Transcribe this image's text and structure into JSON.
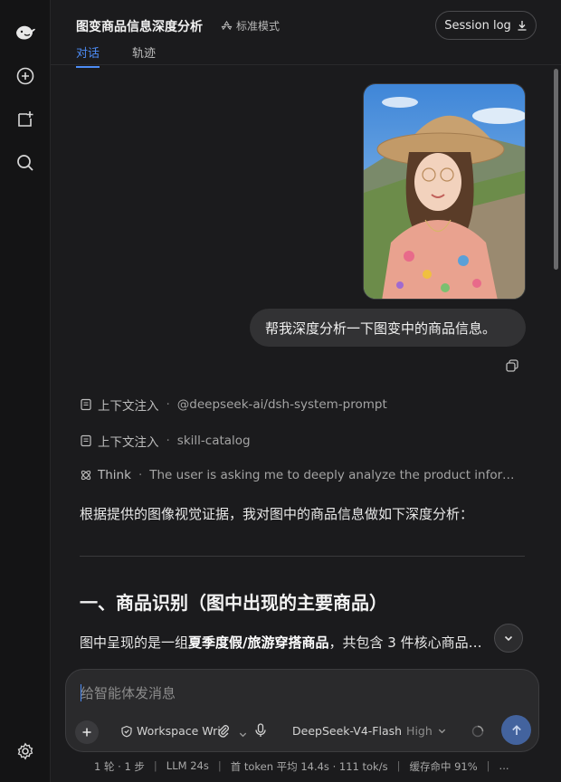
{
  "header": {
    "title": "图变商品信息深度分析",
    "mode_label": "标准模式",
    "session_button": "Session log",
    "tabs": [
      {
        "label": "对话",
        "active": true
      },
      {
        "label": "轨迹",
        "active": false
      }
    ]
  },
  "sidebar": {
    "icons": [
      "whale-logo-icon",
      "new-chat-icon",
      "new-task-icon",
      "search-icon",
      "settings-icon"
    ]
  },
  "conversation": {
    "user_message": "帮我深度分析一下图变中的商品信息。",
    "context_rows": [
      {
        "label": "上下文注入",
        "detail": "@deepseek-ai/dsh-system-prompt"
      },
      {
        "label": "上下文注入",
        "detail": "skill-catalog"
      }
    ],
    "think": {
      "label": "Think",
      "detail": "The user is asking me to deeply analyze the product informati..."
    },
    "answer_intro": "根据提供的图像视觉证据，我对图中的商品信息做如下深度分析：",
    "heading1": "一、商品识别（图中出现的主要商品）",
    "para2_prefix": "图中呈现的是一组",
    "para2_bold": "夏季度假/旅游穿搭商品",
    "para2_suffix": "，共包含 3 件核心商品…"
  },
  "composer": {
    "placeholder": "给智能体发消息",
    "workspace_label": "Workspace Wri",
    "model_name": "DeepSeek-V4-Flash",
    "model_level": "High"
  },
  "footer": {
    "rounds": "1 轮 · 1 步",
    "llm_time": "LLM 24s",
    "token_stats": "首 token 平均 14.4s · 111 tok/s",
    "cache": "缓存命中 91%",
    "more": "..."
  },
  "colors": {
    "accent": "#4d8cf5",
    "send_button": "#43639e",
    "background": "#1b1b1d"
  }
}
